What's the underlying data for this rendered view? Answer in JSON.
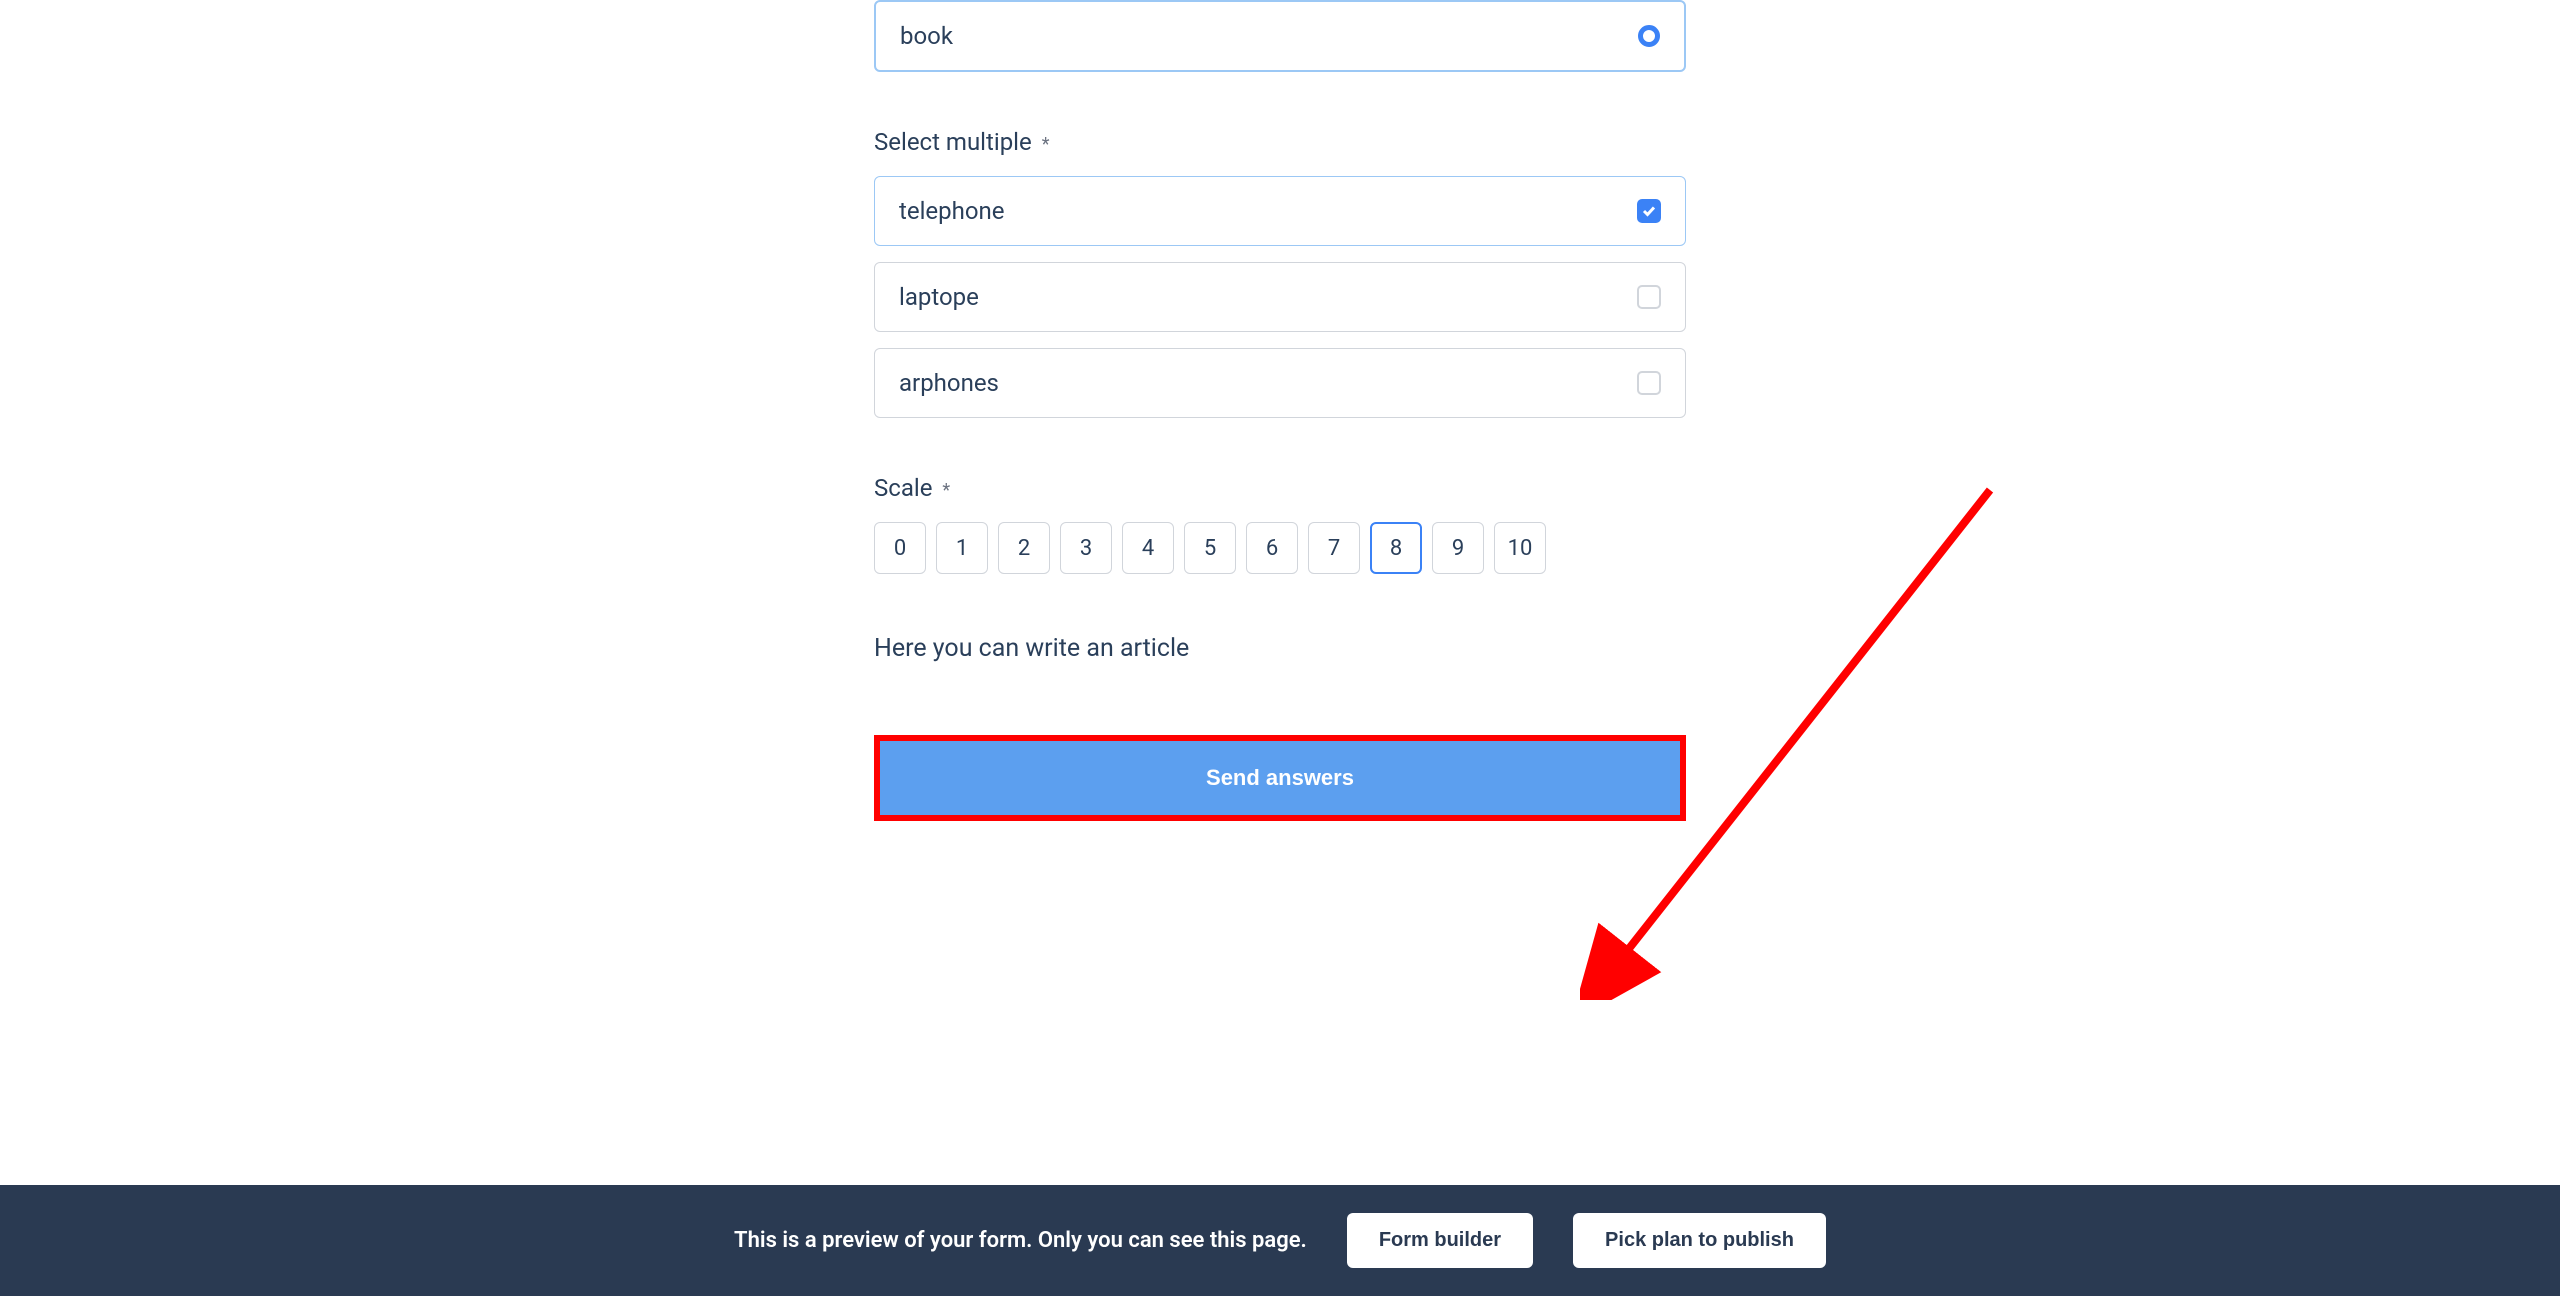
{
  "radio": {
    "options": [
      {
        "label": "book",
        "selected": true
      }
    ]
  },
  "multiSelect": {
    "label": "Select multiple",
    "required": "*",
    "options": [
      {
        "label": "telephone",
        "checked": true
      },
      {
        "label": "laptope",
        "checked": false
      },
      {
        "label": "arphones",
        "checked": false
      }
    ]
  },
  "scale": {
    "label": "Scale",
    "required": "*",
    "values": [
      "0",
      "1",
      "2",
      "3",
      "4",
      "5",
      "6",
      "7",
      "8",
      "9",
      "10"
    ],
    "selected": "8"
  },
  "article": {
    "text": "Here you can write an article"
  },
  "submit": {
    "label": "Send answers"
  },
  "footer": {
    "text": "This is a preview of your form. Only you can see this page.",
    "builderButton": "Form builder",
    "publishButton": "Pick plan to publish"
  }
}
